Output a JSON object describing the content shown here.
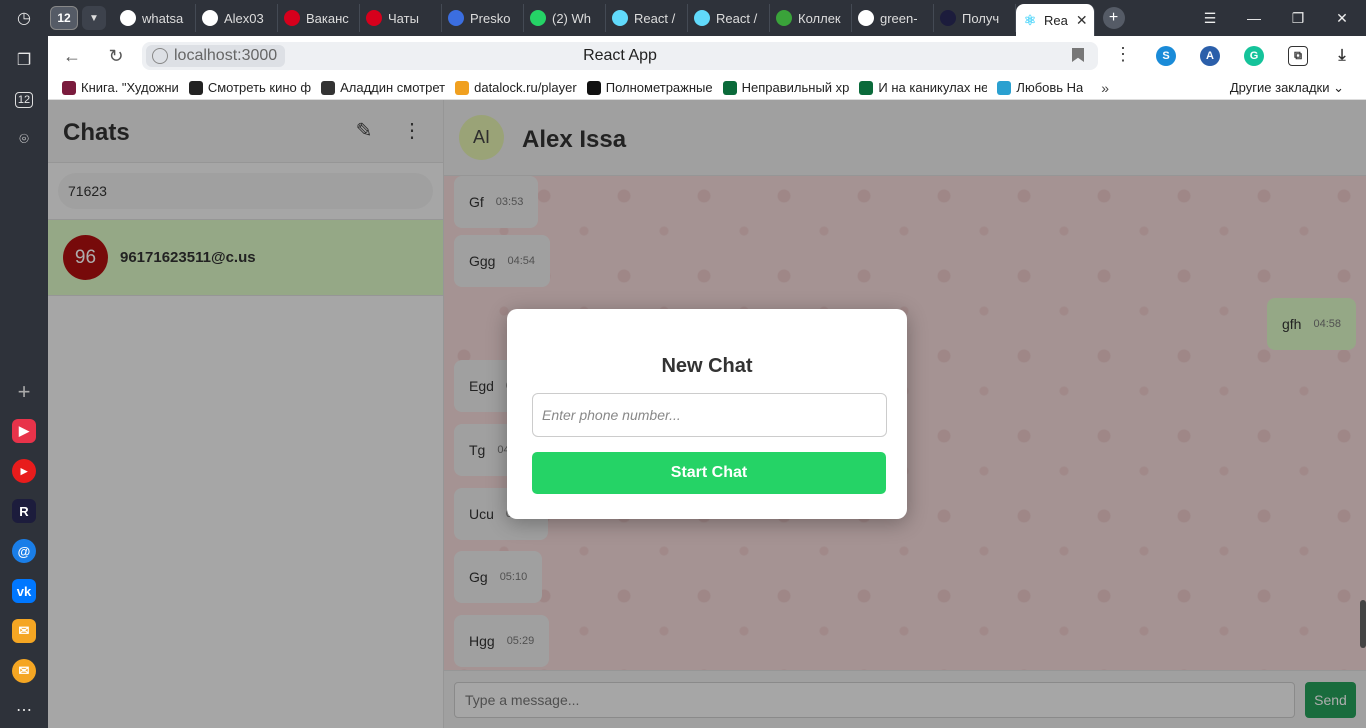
{
  "browser": {
    "tab_count": "12",
    "tabs": [
      {
        "label": "whatsa",
        "icon": "github-icon",
        "color": "#ffffff"
      },
      {
        "label": "Alex03",
        "icon": "github-icon",
        "color": "#ffffff"
      },
      {
        "label": "Ваканс",
        "icon": "hh-icon",
        "color": "#d6001c"
      },
      {
        "label": "Чаты",
        "icon": "hh-icon",
        "color": "#d6001c"
      },
      {
        "label": "Presko",
        "icon": "presko-icon",
        "color": "#3b6ee0"
      },
      {
        "label": "(2) Wh",
        "icon": "whatsapp-icon",
        "color": "#25d366"
      },
      {
        "label": "React /",
        "icon": "react-icon",
        "color": "#61dafb"
      },
      {
        "label": "React /",
        "icon": "react-icon",
        "color": "#61dafb"
      },
      {
        "label": "Коллек",
        "icon": "g-icon",
        "color": "#3aa33a"
      },
      {
        "label": "green-",
        "icon": "github-icon",
        "color": "#ffffff"
      },
      {
        "label": "Получ",
        "icon": "r-icon",
        "color": "#1c1c3c"
      }
    ],
    "active_tab": {
      "label": "Rea",
      "close": "✕"
    },
    "url": "localhost:3000",
    "page_title": "React App",
    "bookmarks": [
      {
        "label": "Книга. \"Художни",
        "color": "#7a1b3d"
      },
      {
        "label": "Смотреть кино ф",
        "color": "#222222"
      },
      {
        "label": "Аладдин смотрет",
        "color": "#333333"
      },
      {
        "label": "datalock.ru/player",
        "color": "#f0a020"
      },
      {
        "label": "Полнометражные",
        "color": "#111111"
      },
      {
        "label": "Неправильный хр",
        "color": "#0a6a3a"
      },
      {
        "label": "И на каникулах не",
        "color": "#0a6a3a"
      },
      {
        "label": "Любовь На",
        "color": "#2aa0d0"
      }
    ],
    "bookmarks_more": "»",
    "other_bookmarks": "Другие закладки"
  },
  "rail": {
    "count_badge": "12"
  },
  "sidebar": {
    "title": "Chats",
    "search_value": "71623",
    "chats": [
      {
        "avatar": "96",
        "name": "96171623511@c.us"
      }
    ]
  },
  "chat": {
    "contact_initials": "AI",
    "contact_name": "Alex Issa",
    "messages": [
      {
        "text": "Gf",
        "time": "03:53",
        "dir": "in"
      },
      {
        "text": "Ggg",
        "time": "04:54",
        "dir": "in"
      },
      {
        "text": "gfh",
        "time": "04:58",
        "dir": "out"
      },
      {
        "text": "Egd",
        "time": "0",
        "dir": "in"
      },
      {
        "text": "Tg",
        "time": "04",
        "dir": "in"
      },
      {
        "text": "Ucu",
        "time": "05:02",
        "dir": "in"
      },
      {
        "text": "Gg",
        "time": "05:10",
        "dir": "in"
      },
      {
        "text": "Hgg",
        "time": "05:29",
        "dir": "in"
      }
    ],
    "input_placeholder": "Type a message...",
    "send_label": "Send"
  },
  "modal": {
    "title": "New Chat",
    "phone_placeholder": "Enter phone number...",
    "start_label": "Start Chat"
  },
  "colors": {
    "accent": "#25d366",
    "selected_chat": "#dcf8c6",
    "chat_bg": "#f3d9d9"
  }
}
